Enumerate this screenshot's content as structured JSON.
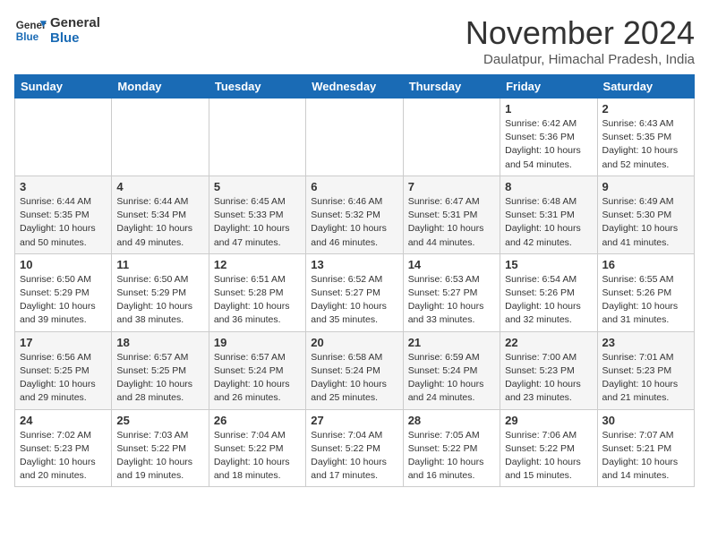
{
  "header": {
    "logo_line1": "General",
    "logo_line2": "Blue",
    "month": "November 2024",
    "location": "Daulatpur, Himachal Pradesh, India"
  },
  "weekdays": [
    "Sunday",
    "Monday",
    "Tuesday",
    "Wednesday",
    "Thursday",
    "Friday",
    "Saturday"
  ],
  "weeks": [
    [
      {
        "day": "",
        "info": ""
      },
      {
        "day": "",
        "info": ""
      },
      {
        "day": "",
        "info": ""
      },
      {
        "day": "",
        "info": ""
      },
      {
        "day": "",
        "info": ""
      },
      {
        "day": "1",
        "info": "Sunrise: 6:42 AM\nSunset: 5:36 PM\nDaylight: 10 hours and 54 minutes."
      },
      {
        "day": "2",
        "info": "Sunrise: 6:43 AM\nSunset: 5:35 PM\nDaylight: 10 hours and 52 minutes."
      }
    ],
    [
      {
        "day": "3",
        "info": "Sunrise: 6:44 AM\nSunset: 5:35 PM\nDaylight: 10 hours and 50 minutes."
      },
      {
        "day": "4",
        "info": "Sunrise: 6:44 AM\nSunset: 5:34 PM\nDaylight: 10 hours and 49 minutes."
      },
      {
        "day": "5",
        "info": "Sunrise: 6:45 AM\nSunset: 5:33 PM\nDaylight: 10 hours and 47 minutes."
      },
      {
        "day": "6",
        "info": "Sunrise: 6:46 AM\nSunset: 5:32 PM\nDaylight: 10 hours and 46 minutes."
      },
      {
        "day": "7",
        "info": "Sunrise: 6:47 AM\nSunset: 5:31 PM\nDaylight: 10 hours and 44 minutes."
      },
      {
        "day": "8",
        "info": "Sunrise: 6:48 AM\nSunset: 5:31 PM\nDaylight: 10 hours and 42 minutes."
      },
      {
        "day": "9",
        "info": "Sunrise: 6:49 AM\nSunset: 5:30 PM\nDaylight: 10 hours and 41 minutes."
      }
    ],
    [
      {
        "day": "10",
        "info": "Sunrise: 6:50 AM\nSunset: 5:29 PM\nDaylight: 10 hours and 39 minutes."
      },
      {
        "day": "11",
        "info": "Sunrise: 6:50 AM\nSunset: 5:29 PM\nDaylight: 10 hours and 38 minutes."
      },
      {
        "day": "12",
        "info": "Sunrise: 6:51 AM\nSunset: 5:28 PM\nDaylight: 10 hours and 36 minutes."
      },
      {
        "day": "13",
        "info": "Sunrise: 6:52 AM\nSunset: 5:27 PM\nDaylight: 10 hours and 35 minutes."
      },
      {
        "day": "14",
        "info": "Sunrise: 6:53 AM\nSunset: 5:27 PM\nDaylight: 10 hours and 33 minutes."
      },
      {
        "day": "15",
        "info": "Sunrise: 6:54 AM\nSunset: 5:26 PM\nDaylight: 10 hours and 32 minutes."
      },
      {
        "day": "16",
        "info": "Sunrise: 6:55 AM\nSunset: 5:26 PM\nDaylight: 10 hours and 31 minutes."
      }
    ],
    [
      {
        "day": "17",
        "info": "Sunrise: 6:56 AM\nSunset: 5:25 PM\nDaylight: 10 hours and 29 minutes."
      },
      {
        "day": "18",
        "info": "Sunrise: 6:57 AM\nSunset: 5:25 PM\nDaylight: 10 hours and 28 minutes."
      },
      {
        "day": "19",
        "info": "Sunrise: 6:57 AM\nSunset: 5:24 PM\nDaylight: 10 hours and 26 minutes."
      },
      {
        "day": "20",
        "info": "Sunrise: 6:58 AM\nSunset: 5:24 PM\nDaylight: 10 hours and 25 minutes."
      },
      {
        "day": "21",
        "info": "Sunrise: 6:59 AM\nSunset: 5:24 PM\nDaylight: 10 hours and 24 minutes."
      },
      {
        "day": "22",
        "info": "Sunrise: 7:00 AM\nSunset: 5:23 PM\nDaylight: 10 hours and 23 minutes."
      },
      {
        "day": "23",
        "info": "Sunrise: 7:01 AM\nSunset: 5:23 PM\nDaylight: 10 hours and 21 minutes."
      }
    ],
    [
      {
        "day": "24",
        "info": "Sunrise: 7:02 AM\nSunset: 5:23 PM\nDaylight: 10 hours and 20 minutes."
      },
      {
        "day": "25",
        "info": "Sunrise: 7:03 AM\nSunset: 5:22 PM\nDaylight: 10 hours and 19 minutes."
      },
      {
        "day": "26",
        "info": "Sunrise: 7:04 AM\nSunset: 5:22 PM\nDaylight: 10 hours and 18 minutes."
      },
      {
        "day": "27",
        "info": "Sunrise: 7:04 AM\nSunset: 5:22 PM\nDaylight: 10 hours and 17 minutes."
      },
      {
        "day": "28",
        "info": "Sunrise: 7:05 AM\nSunset: 5:22 PM\nDaylight: 10 hours and 16 minutes."
      },
      {
        "day": "29",
        "info": "Sunrise: 7:06 AM\nSunset: 5:22 PM\nDaylight: 10 hours and 15 minutes."
      },
      {
        "day": "30",
        "info": "Sunrise: 7:07 AM\nSunset: 5:21 PM\nDaylight: 10 hours and 14 minutes."
      }
    ]
  ]
}
